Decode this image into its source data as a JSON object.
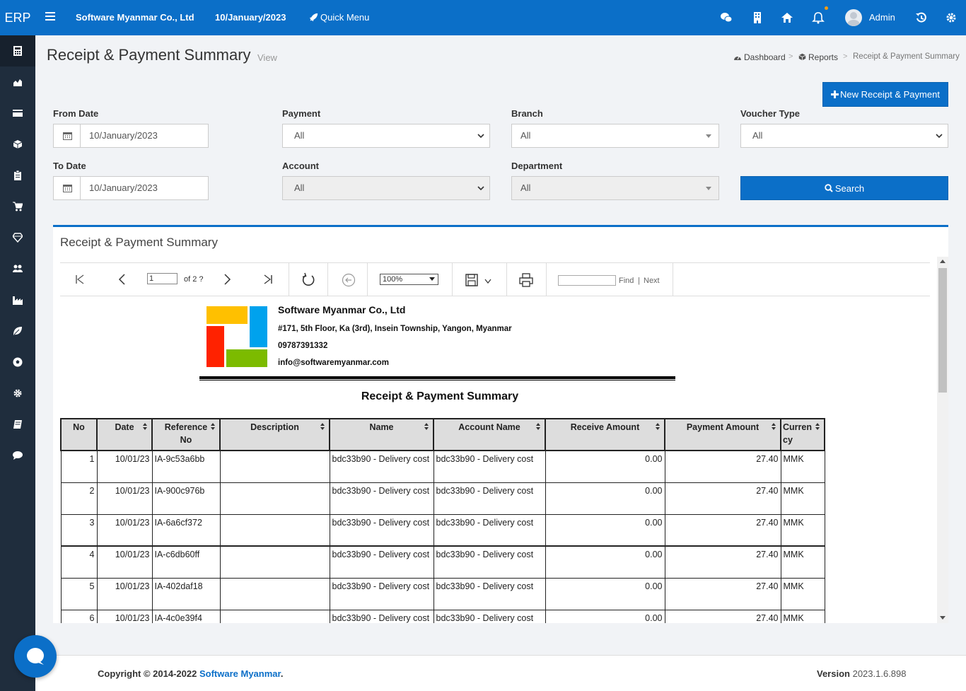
{
  "topbar": {
    "brand": "ERP",
    "company": "Software Myanmar Co., Ltd",
    "date": "10/January/2023",
    "quick_menu": "Quick Menu",
    "user": "Admin"
  },
  "sidebar": {
    "items": [
      "calculator-icon",
      "area-chart-icon",
      "credit-card-icon",
      "cube-icon",
      "clipboard-icon",
      "cart-icon",
      "diamond-icon",
      "users-icon",
      "industry-icon",
      "leaf-icon",
      "soccer-ball-icon",
      "gear-icon",
      "book-icon",
      "comment-icon"
    ]
  },
  "header": {
    "title": "Receipt & Payment Summary",
    "subtitle": "View",
    "breadcrumb": {
      "dashboard": "Dashboard",
      "reports": "Reports",
      "current": "Receipt & Payment Summary"
    },
    "new_button": "New Receipt & Payment"
  },
  "filters": {
    "from_date": {
      "label": "From Date",
      "value": "10/January/2023"
    },
    "to_date": {
      "label": "To Date",
      "value": "10/January/2023"
    },
    "payment": {
      "label": "Payment",
      "value": "All"
    },
    "account": {
      "label": "Account",
      "value": "All"
    },
    "branch": {
      "label": "Branch",
      "value": "All"
    },
    "department": {
      "label": "Department",
      "value": "All"
    },
    "voucher_type": {
      "label": "Voucher Type",
      "value": "All"
    },
    "search_button": "Search"
  },
  "panel": {
    "title": "Receipt & Payment Summary"
  },
  "viewer": {
    "page_value": "1",
    "page_of": "of 2 ?",
    "zoom": "100%",
    "find_label": "Find",
    "find_sep": "|",
    "next_label": "Next"
  },
  "report": {
    "company_name": "Software Myanmar Co., Ltd",
    "address": "#171, 5th Floor, Ka (3rd), Insein Township, Yangon, Myanmar",
    "phone": "09787391332",
    "email": "info@softwaremyanmar.com",
    "title": "Receipt & Payment Summary",
    "columns": [
      "No",
      "Date",
      "Reference No",
      "Description",
      "Name",
      "Account Name",
      "Receive Amount",
      "Payment Amount",
      "Currency"
    ],
    "rows": [
      [
        "1",
        "10/01/23",
        "IA-9c53a6bb",
        "",
        "bdc33b90 - Delivery cost",
        "bdc33b90 - Delivery cost",
        "0.00",
        "27.40",
        "MMK"
      ],
      [
        "2",
        "10/01/23",
        "IA-900c976b",
        "",
        "bdc33b90 - Delivery cost",
        "bdc33b90 - Delivery cost",
        "0.00",
        "27.40",
        "MMK"
      ],
      [
        "3",
        "10/01/23",
        "IA-6a6cf372",
        "",
        "bdc33b90 - Delivery cost",
        "bdc33b90 - Delivery cost",
        "0.00",
        "27.40",
        "MMK"
      ],
      [
        "4",
        "10/01/23",
        "IA-c6db60ff",
        "",
        "bdc33b90 - Delivery cost",
        "bdc33b90 - Delivery cost",
        "0.00",
        "27.40",
        "MMK"
      ],
      [
        "5",
        "10/01/23",
        "IA-402daf18",
        "",
        "bdc33b90 - Delivery cost",
        "bdc33b90 - Delivery cost",
        "0.00",
        "27.40",
        "MMK"
      ],
      [
        "6",
        "10/01/23",
        "IA-4c0e39f4",
        "",
        "bdc33b90 - Delivery cost",
        "bdc33b90 - Delivery cost",
        "0.00",
        "27.40",
        "MMK"
      ]
    ]
  },
  "footer": {
    "copyright": "Copyright © 2014-2022",
    "company_link": "Software Myanmar",
    "period": ".",
    "version_label": "Version",
    "version": "2023.1.6.898"
  },
  "colors": {
    "primary": "#0b6fc8",
    "sidebar": "#1f2d3d",
    "logo_yellow": "#ffc000",
    "logo_blue": "#00a2ed",
    "logo_red": "#ff2200",
    "logo_green": "#7cbb00"
  }
}
